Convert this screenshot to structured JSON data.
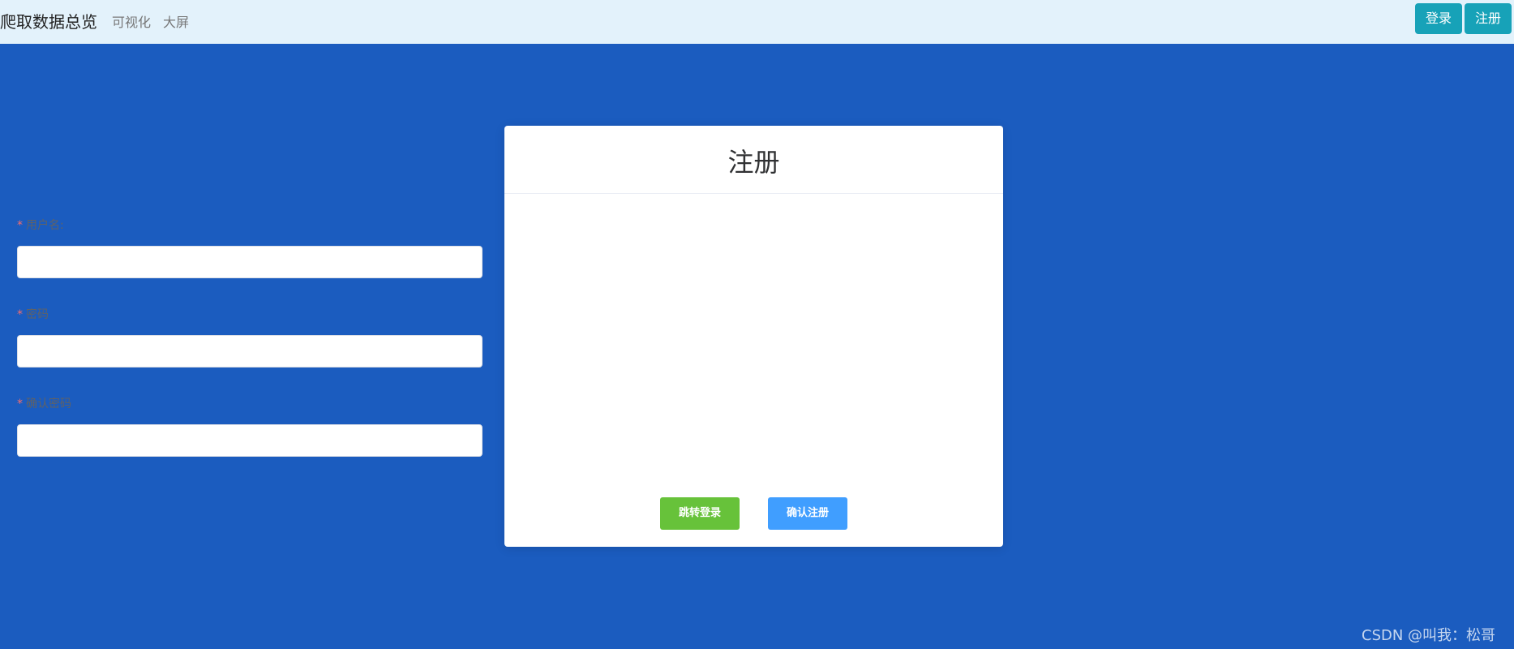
{
  "navbar": {
    "brand": "爬取数据总览",
    "links": [
      "可视化",
      "大屏"
    ],
    "login_label": "登录",
    "register_label": "注册"
  },
  "colors": {
    "page_background": "#1b5cbf",
    "navbar_background": "#e3f2fb",
    "top_button": "#17a2b8",
    "goto_login_button": "#67c23a",
    "confirm_button": "#409eff",
    "required_mark": "#f56c6c"
  },
  "form": {
    "title": "注册",
    "required_mark": "*",
    "fields": [
      {
        "label": "用户名:",
        "value": "",
        "placeholder": ""
      },
      {
        "label": "密码",
        "value": "",
        "placeholder": ""
      },
      {
        "label": "确认密码",
        "value": "",
        "placeholder": ""
      }
    ],
    "goto_login_label": "跳转登录",
    "confirm_label": "确认注册"
  },
  "watermark": "CSDN @叫我：松哥"
}
